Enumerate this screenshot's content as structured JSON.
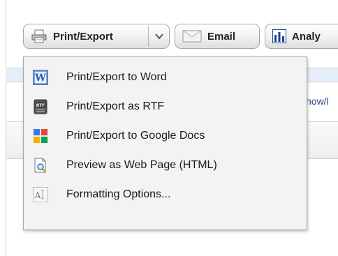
{
  "toolbar": {
    "print_export_label": "Print/Export",
    "email_label": "Email",
    "analy_label": "Analy"
  },
  "background": {
    "partial_link": "how/l"
  },
  "menu": {
    "items": [
      {
        "label": "Print/Export to Word",
        "icon": "word-icon"
      },
      {
        "label": "Print/Export as RTF",
        "icon": "rtf-icon"
      },
      {
        "label": "Print/Export to Google Docs",
        "icon": "google-docs-icon"
      },
      {
        "label": "Preview as Web Page (HTML)",
        "icon": "preview-icon"
      },
      {
        "label": "Formatting Options...",
        "icon": "formatting-icon"
      }
    ]
  },
  "colors": {
    "word_blue": "#2b5fb3",
    "google_blue": "#3b78e7",
    "google_red": "#dd4b39",
    "google_yellow": "#f4b400",
    "google_green": "#0f9d58"
  }
}
